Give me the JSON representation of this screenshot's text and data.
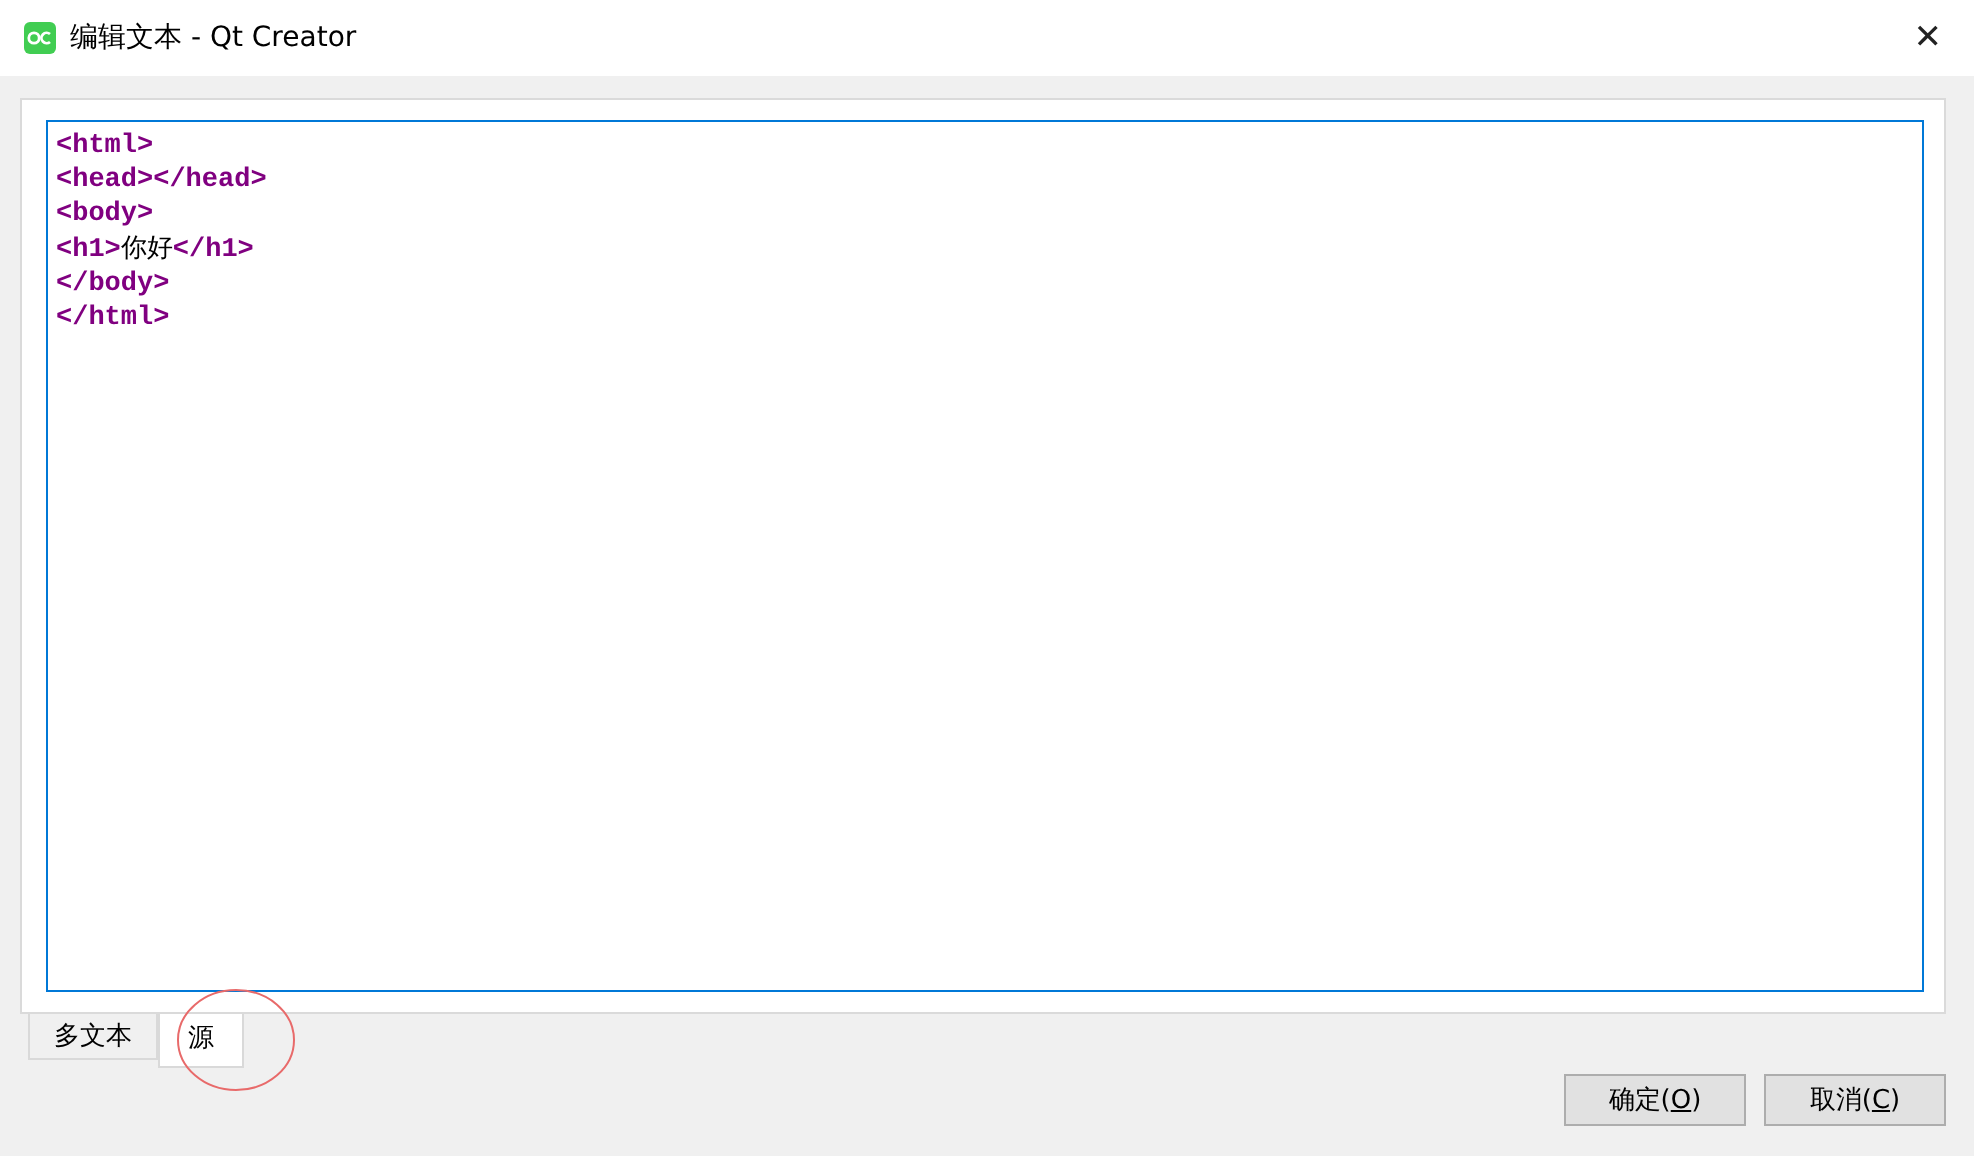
{
  "window": {
    "title": "编辑文本 - Qt Creator",
    "close": "✕"
  },
  "editor": {
    "lines": [
      [
        {
          "kind": "tag",
          "text": "<html>"
        }
      ],
      [
        {
          "kind": "tag",
          "text": "<head></head>"
        }
      ],
      [
        {
          "kind": "tag",
          "text": "<body>"
        }
      ],
      [
        {
          "kind": "tag",
          "text": "<h1>"
        },
        {
          "kind": "text",
          "text": "你好"
        },
        {
          "kind": "tag",
          "text": "</h1>"
        }
      ],
      [
        {
          "kind": "tag",
          "text": "</body>"
        }
      ],
      [
        {
          "kind": "tag",
          "text": "</html>"
        }
      ]
    ]
  },
  "tabs": [
    {
      "label": "多文本",
      "selected": false
    },
    {
      "label": "源",
      "selected": true
    }
  ],
  "buttons": [
    {
      "prefix": "确定(",
      "mnemonic": "O",
      "suffix": ")"
    },
    {
      "prefix": "取消(",
      "mnemonic": "C",
      "suffix": ")"
    }
  ]
}
